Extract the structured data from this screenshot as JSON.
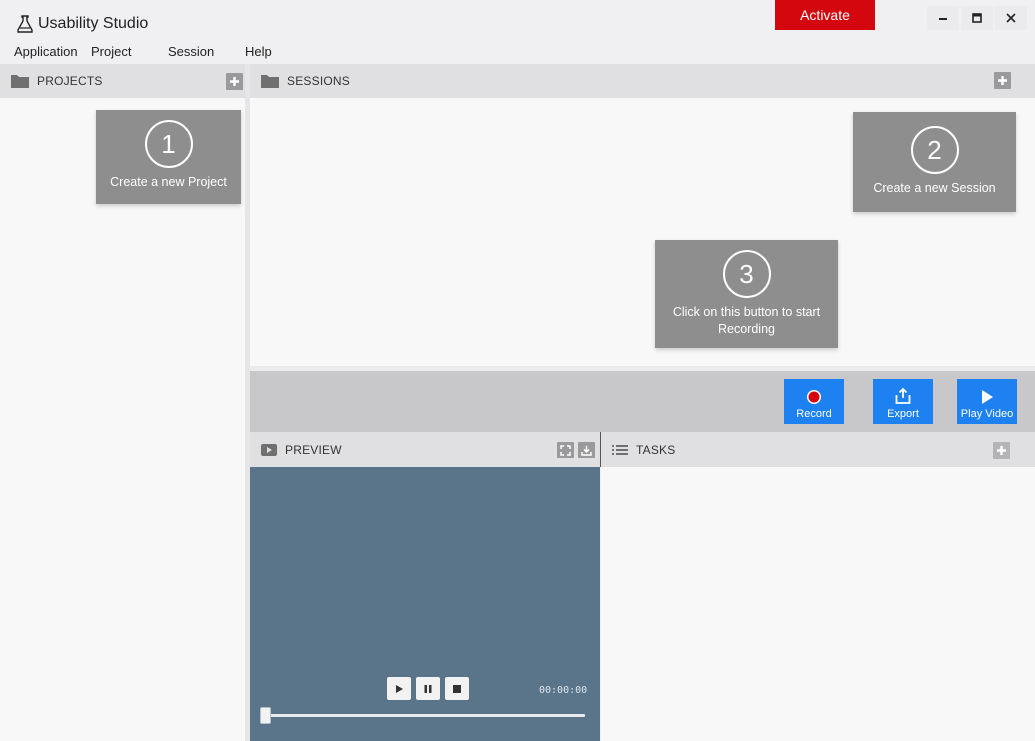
{
  "app": {
    "title": "Usability Studio",
    "activate_label": "Activate"
  },
  "window_controls": {
    "minimize": "–",
    "maximize": "■",
    "close": "✕"
  },
  "menu": [
    "Application",
    "Project",
    "Session",
    "Help"
  ],
  "projects_panel": {
    "title": "PROJECTS",
    "add_icon": "plus-icon"
  },
  "sessions_panel": {
    "title": "SESSIONS",
    "add_icon": "plus-icon"
  },
  "tips": [
    {
      "number": "1",
      "text": "Create a new Project"
    },
    {
      "number": "2",
      "text": "Create a new Session"
    },
    {
      "number": "3",
      "text": "Click on this button to start Recording"
    }
  ],
  "actions": [
    {
      "label": "Record",
      "icon": "record-icon"
    },
    {
      "label": "Export",
      "icon": "export-icon"
    },
    {
      "label": "Play Video",
      "icon": "play-icon"
    }
  ],
  "preview_panel": {
    "title": "PREVIEW",
    "timecode": "00:00:00",
    "seek": 0
  },
  "tasks_panel": {
    "title": "TASKS"
  },
  "colors": {
    "accent": "#1e81f2",
    "activate": "#d4070f",
    "record_dot": "#d4070f",
    "tooltip": "#8e8e8e",
    "video_bg": "#5a7489"
  }
}
